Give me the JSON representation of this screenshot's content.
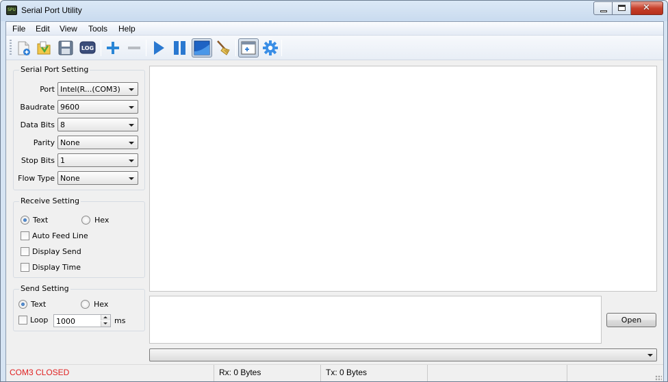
{
  "window": {
    "title": "Serial Port Utility",
    "icon_text": "SPU",
    "controls": [
      "minimize-icon",
      "maximize-icon",
      "close-icon"
    ]
  },
  "menu": {
    "items": [
      "File",
      "Edit",
      "View",
      "Tools",
      "Help"
    ]
  },
  "toolbar": {
    "buttons": [
      {
        "name": "new-icon"
      },
      {
        "name": "open-folder-icon"
      },
      {
        "name": "save-icon"
      },
      {
        "name": "log-icon",
        "label": "LOG"
      },
      {
        "name": "add-icon"
      },
      {
        "name": "remove-icon"
      },
      {
        "name": "play-icon"
      },
      {
        "name": "pause-icon"
      },
      {
        "name": "display-mode-icon"
      },
      {
        "name": "broom-clear-icon"
      },
      {
        "name": "add-window-icon"
      },
      {
        "name": "gear-icon"
      }
    ]
  },
  "serial_port_setting": {
    "title": "Serial Port Setting",
    "fields": [
      {
        "label": "Port",
        "value": "Intel(R...(COM3)"
      },
      {
        "label": "Baudrate",
        "value": "9600"
      },
      {
        "label": "Data Bits",
        "value": "8"
      },
      {
        "label": "Parity",
        "value": "None"
      },
      {
        "label": "Stop Bits",
        "value": "1"
      },
      {
        "label": "Flow Type",
        "value": "None"
      }
    ]
  },
  "receive_setting": {
    "title": "Receive Setting",
    "text_label": "Text",
    "hex_label": "Hex",
    "auto_feed_line": "Auto Feed Line",
    "display_send": "Display Send",
    "display_time": "Display Time"
  },
  "send_setting": {
    "title": "Send Setting",
    "text_label": "Text",
    "hex_label": "Hex",
    "loop_label": "Loop",
    "loop_value": "1000",
    "unit": "ms"
  },
  "actions": {
    "open_label": "Open"
  },
  "status": {
    "port_state": "COM3 CLOSED",
    "rx": "Rx: 0 Bytes",
    "tx": "Tx: 0 Bytes"
  },
  "colors": {
    "status_closed": "#e02020",
    "accent_blue": "#2a78d0"
  }
}
